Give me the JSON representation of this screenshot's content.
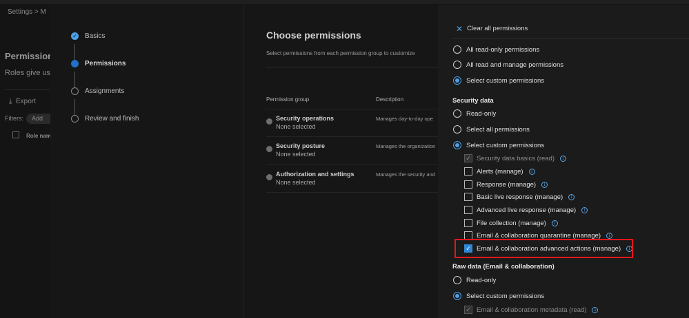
{
  "background": {
    "breadcrumb": "Settings  >  M",
    "title": "Permission",
    "subtitle": "Roles give use",
    "export_label": "Export",
    "filters_label": "Filters:",
    "add_chip": "Add",
    "role_name_header": "Role nam"
  },
  "wizard": {
    "steps": [
      {
        "label": "Basics",
        "state": "done"
      },
      {
        "label": "Permissions",
        "state": "current"
      },
      {
        "label": "Assignments",
        "state": "todo"
      },
      {
        "label": "Review and finish",
        "state": "todo"
      }
    ],
    "title": "Choose permissions",
    "description": "Select permissions from each permission group to customize",
    "columns": {
      "group": "Permission group",
      "description": "Description"
    },
    "groups": [
      {
        "name": "Security operations",
        "selected": "None selected",
        "desc": "Manages day-to-day ope"
      },
      {
        "name": "Security posture",
        "selected": "None selected",
        "desc": "Manages the organization"
      },
      {
        "name": "Authorization and settings",
        "selected": "None selected",
        "desc": "Manages the security and"
      }
    ]
  },
  "flyout": {
    "clear_all": "Clear all permissions",
    "top_options": [
      {
        "label": "All read-only permissions",
        "selected": false
      },
      {
        "label": "All read and manage permissions",
        "selected": false
      },
      {
        "label": "Select custom permissions",
        "selected": true
      }
    ],
    "security_data": {
      "heading": "Security data",
      "options": [
        {
          "label": "Read-only",
          "selected": false
        },
        {
          "label": "Select all permissions",
          "selected": false
        },
        {
          "label": "Select custom permissions",
          "selected": true
        }
      ],
      "items": [
        {
          "label": "Security data basics (read)",
          "checked": true,
          "disabled": true
        },
        {
          "label": "Alerts (manage)",
          "checked": false,
          "disabled": false
        },
        {
          "label": "Response (manage)",
          "checked": false,
          "disabled": false
        },
        {
          "label": "Basic live response (manage)",
          "checked": false,
          "disabled": false
        },
        {
          "label": "Advanced live response (manage)",
          "checked": false,
          "disabled": false
        },
        {
          "label": "File collection (manage)",
          "checked": false,
          "disabled": false
        },
        {
          "label": "Email & collaboration quarantine (manage)",
          "checked": false,
          "disabled": false
        },
        {
          "label": "Email & collaboration advanced actions (manage)",
          "checked": true,
          "disabled": false
        }
      ]
    },
    "raw_data": {
      "heading": "Raw data (Email & collaboration)",
      "options": [
        {
          "label": "Read-only",
          "selected": false
        },
        {
          "label": "Select custom permissions",
          "selected": true
        }
      ],
      "items": [
        {
          "label": "Email & collaboration metadata (read)",
          "checked": true,
          "disabled": true
        }
      ]
    },
    "check_glyph": "✓",
    "info_glyph": "i",
    "close_glyph": "✕"
  },
  "colors": {
    "accent": "#4ea1e6",
    "checkbox_checked": "#2f86d6",
    "highlight_box": "#e4161b",
    "panel": "#1b1b1b"
  }
}
